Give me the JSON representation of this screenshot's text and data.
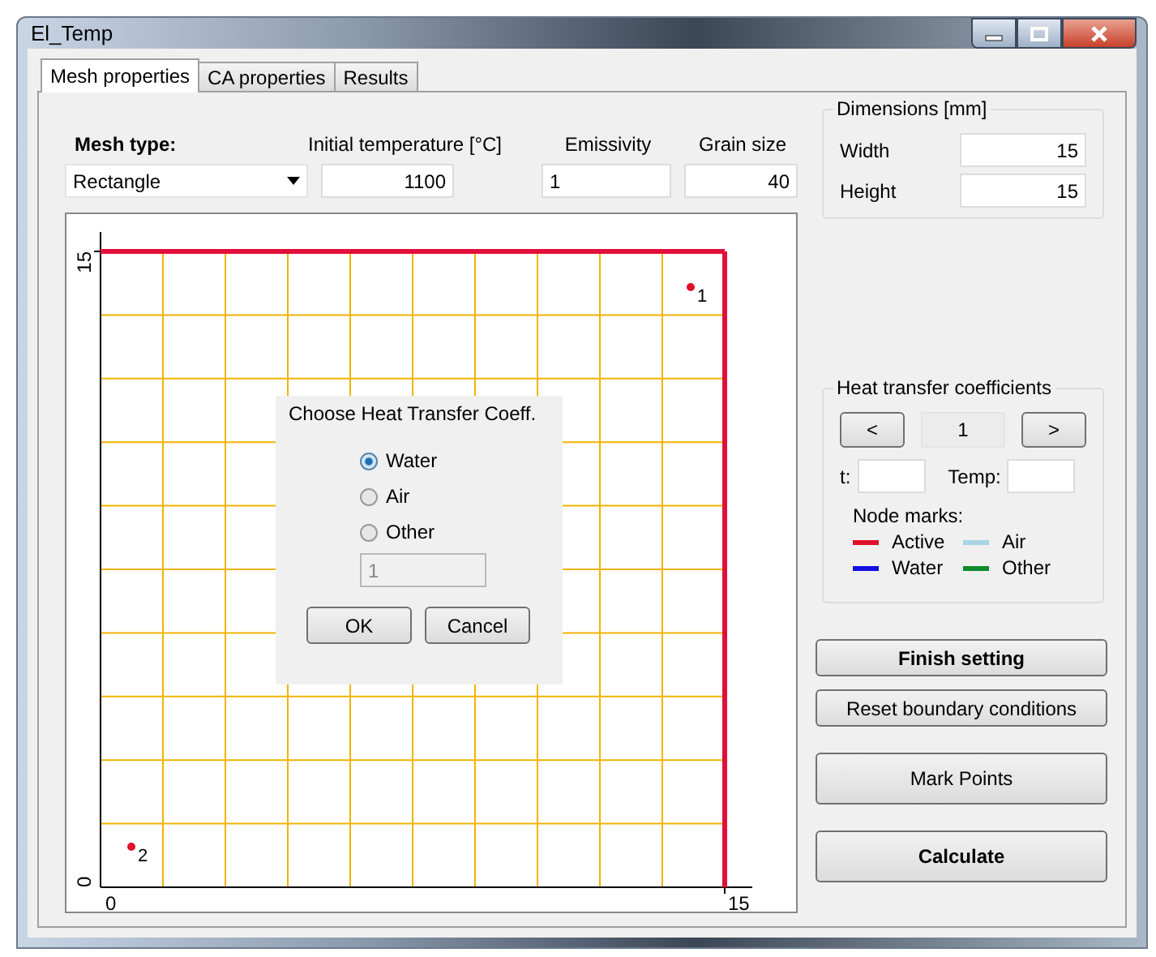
{
  "window": {
    "title": "El_Temp"
  },
  "tabs": [
    {
      "label": "Mesh properties",
      "selected": true
    },
    {
      "label": "CA properties",
      "selected": false
    },
    {
      "label": "Results",
      "selected": false
    }
  ],
  "mesh_type": {
    "label": "Mesh type:",
    "value": "Rectangle"
  },
  "initial_temperature": {
    "label": "Initial temperature [°C]",
    "value": "1100"
  },
  "emissivity": {
    "label": "Emissivity",
    "value": "1"
  },
  "grain_size": {
    "label": "Grain size",
    "value": "40"
  },
  "dimensions": {
    "title": "Dimensions [mm]",
    "rows": [
      {
        "label": "Width",
        "value": "15"
      },
      {
        "label": "Height",
        "value": "15"
      }
    ]
  },
  "mesh": {
    "top_edge_active": true,
    "right_edge_active": true,
    "y_axis_labels": [
      "15",
      "0"
    ],
    "x_axis_labels": [
      "0",
      "15"
    ],
    "points": [
      {
        "label": "1"
      },
      {
        "label": "2"
      }
    ]
  },
  "dialog": {
    "title": "Choose Heat Transfer Coeff.",
    "options": [
      {
        "label": "Water",
        "selected": true
      },
      {
        "label": "Air",
        "selected": false
      },
      {
        "label": "Other",
        "selected": false
      }
    ],
    "value_field": {
      "value": "1",
      "disabled": true
    },
    "ok": "OK",
    "cancel": "Cancel"
  },
  "heat_transfer": {
    "title": "Heat transfer coefficients",
    "prev": "<",
    "index": "1",
    "next": ">",
    "t_label": "t:",
    "temp_label": "Temp:",
    "node_marks_label": "Node marks:",
    "legend": [
      {
        "label": "Active",
        "color": "#e0102a"
      },
      {
        "label": "Air",
        "color": "#a8d4e6"
      },
      {
        "label": "Water",
        "color": "#1010e0"
      },
      {
        "label": "Other",
        "color": "#108a2a"
      }
    ]
  },
  "finish_button": "Finish setting",
  "reset_button": "Reset boundary conditions",
  "mark_points_button": "Mark Points",
  "calculate_button": "Calculate"
}
